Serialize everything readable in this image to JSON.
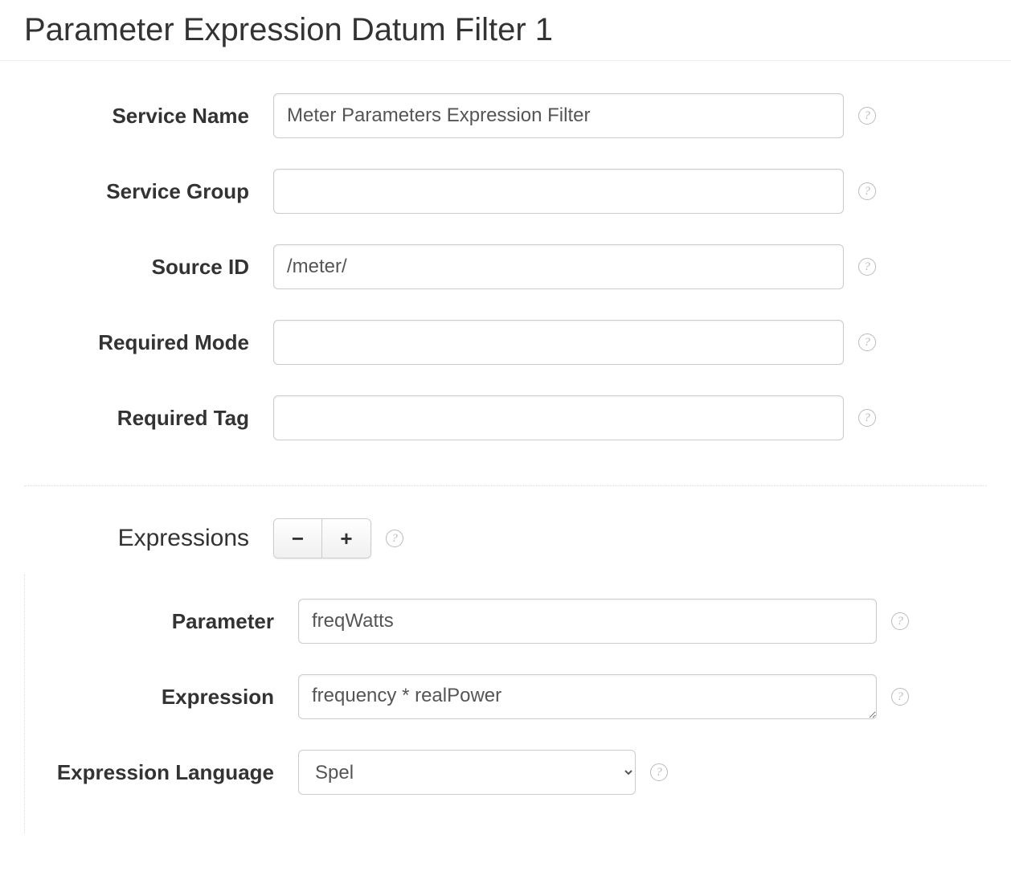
{
  "title": "Parameter Expression Datum Filter 1",
  "fields": {
    "serviceName": {
      "label": "Service Name",
      "value": "Meter Parameters Expression Filter"
    },
    "serviceGroup": {
      "label": "Service Group",
      "value": ""
    },
    "sourceId": {
      "label": "Source ID",
      "value": "/meter/"
    },
    "requiredMode": {
      "label": "Required Mode",
      "value": ""
    },
    "requiredTag": {
      "label": "Required Tag",
      "value": ""
    }
  },
  "expressions": {
    "label": "Expressions",
    "minus": "−",
    "plus": "+",
    "items": [
      {
        "parameter": {
          "label": "Parameter",
          "value": "freqWatts"
        },
        "expression": {
          "label": "Expression",
          "value": "frequency * realPower"
        },
        "expressionLanguage": {
          "label": "Expression Language",
          "value": "Spel"
        }
      }
    ]
  },
  "helpGlyph": "?"
}
